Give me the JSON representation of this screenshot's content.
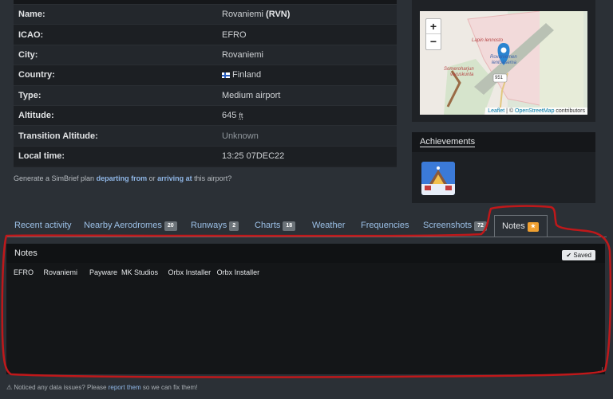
{
  "airport_info": {
    "rows": [
      {
        "label": "Name:",
        "value": "Rovaniemi ",
        "extra": "(RVN)"
      },
      {
        "label": "ICAO:",
        "value": "EFRO"
      },
      {
        "label": "City:",
        "value": "Rovaniemi"
      },
      {
        "label": "Country:",
        "value": "Finland"
      },
      {
        "label": "Type:",
        "value": "Medium airport"
      },
      {
        "label": "Altitude:",
        "value": "645 ",
        "unit": "ft"
      },
      {
        "label": "Transition Altitude:",
        "value": "Unknown"
      },
      {
        "label": "Local time:",
        "value": "13:25 07DEC22"
      }
    ]
  },
  "simbrief": {
    "prefix": "Generate a SimBrief plan",
    "departing": "departing from",
    "or": "or",
    "arriving": "arriving at",
    "suffix": "this airport?"
  },
  "map": {
    "zoom_in": "+",
    "zoom_out": "−",
    "labels": {
      "lapin": "Lapin lennosto",
      "rovaniemen": "Rovaniemen",
      "lentoasema": "lentoasema",
      "someroharjun": "Someroharjun",
      "varuskunta": "varuskunta",
      "road": "951"
    },
    "attribution": {
      "leaflet": "Leaflet",
      "sep": " | © ",
      "osm": "OpenStreetMap",
      "rest": " contributors"
    }
  },
  "achievements": {
    "title": "Achievements"
  },
  "tabs": [
    {
      "label": "Recent activity"
    },
    {
      "label": "Nearby Aerodromes",
      "badge": "20"
    },
    {
      "label": "Runways",
      "badge": "2"
    },
    {
      "label": "Charts",
      "badge": "18"
    },
    {
      "label": "Weather"
    },
    {
      "label": "Frequencies"
    },
    {
      "label": "Screenshots",
      "badge": "72"
    },
    {
      "label": "Notes",
      "badge": "★"
    }
  ],
  "notes": {
    "title": "Notes",
    "saved": "Saved",
    "text": "EFRO     Rovaniemi      Payware  MK Studios     Orbx Installer   Orbx Installer"
  },
  "footer": {
    "prefix": "Noticed any data issues? Please",
    "link": "report them",
    "suffix": "so we can fix them!"
  },
  "colors": {
    "annotation": "#c0181a",
    "accent": "#9cc1e8",
    "star_badge": "#f0a030"
  }
}
